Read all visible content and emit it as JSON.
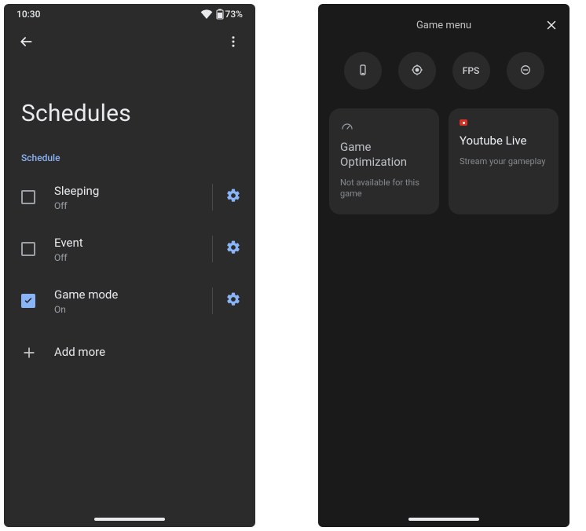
{
  "status": {
    "time": "10:30",
    "battery_text": "73%"
  },
  "schedules": {
    "title": "Schedules",
    "section_label": "Schedule",
    "items": [
      {
        "title": "Sleeping",
        "subtitle": "Off",
        "checked": false
      },
      {
        "title": "Event",
        "subtitle": "Off",
        "checked": false
      },
      {
        "title": "Game mode",
        "subtitle": "On",
        "checked": true
      }
    ],
    "add_more": "Add more"
  },
  "game_menu": {
    "title": "Game menu",
    "icons": {
      "fps_label": "FPS"
    },
    "cards": [
      {
        "title": "Game Optimization",
        "subtitle": "Not available for this game"
      },
      {
        "title": "Youtube Live",
        "subtitle": "Stream your gameplay"
      }
    ]
  }
}
